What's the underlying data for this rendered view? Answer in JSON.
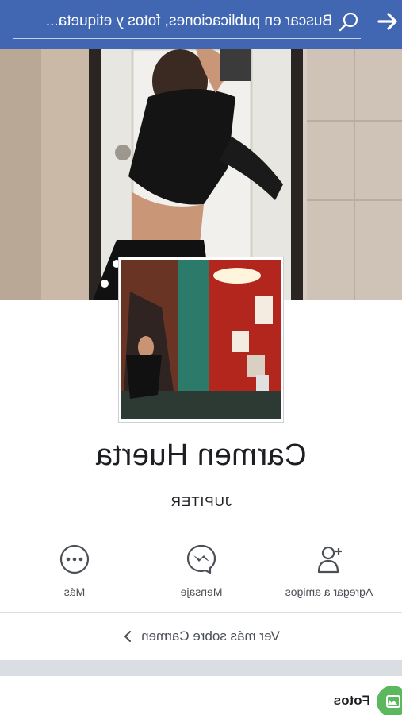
{
  "header": {
    "search_text": "Buscar en publicaciones, fotos y etiqueta...",
    "color": "#4267b2"
  },
  "profile": {
    "name": "Carmen Huerta",
    "bio": "JUPITER"
  },
  "actions": [
    {
      "label": "Agregar a amigos",
      "icon": "add-friend-icon"
    },
    {
      "label": "Mensaje",
      "icon": "messenger-icon"
    },
    {
      "label": "Más",
      "icon": "more-icon"
    }
  ],
  "see_more": {
    "label": "Ver más sobre Carmen",
    "icon": "chevron-right-icon"
  },
  "photos_section": {
    "label": "Fotos",
    "icon": "photos-icon",
    "color": "#5cb85c"
  }
}
